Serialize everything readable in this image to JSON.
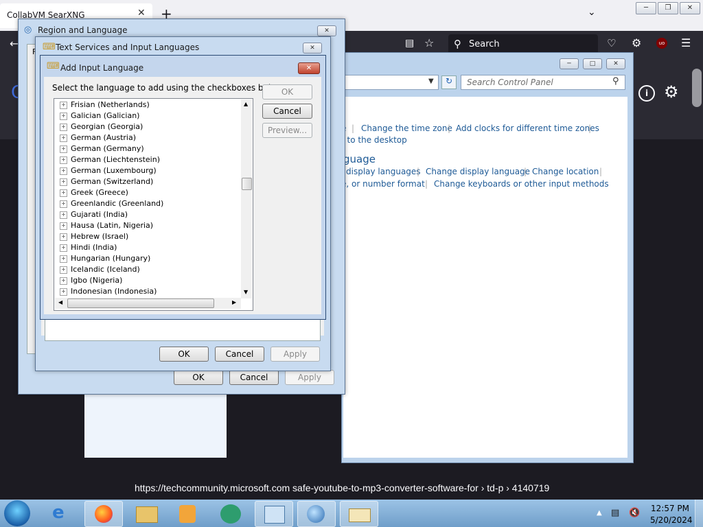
{
  "browser": {
    "tab_title": "CollabVM SearXNG",
    "tab_close": "✕",
    "new_tab": "+",
    "search_label": "Search",
    "status_url": "https://techcommunity.microsoft.com  safe-youtube-to-mp3-converter-software-for › td-p › 4140719"
  },
  "control_panel": {
    "search_placeholder": "Search Control Panel",
    "row1": [
      "e",
      "Change the time zone",
      "Add clocks for different time zones"
    ],
    "row2": "t to the desktop",
    "heading": "guage",
    "row3": [
      "display languages",
      "Change display language",
      "Change location"
    ],
    "row4": [
      "e, or number format",
      "Change keyboards or other input methods"
    ]
  },
  "region_dialog": {
    "title": "Region and Language",
    "tab_hint": "F",
    "ok": "OK",
    "cancel": "Cancel",
    "apply": "Apply"
  },
  "text_services_dialog": {
    "title": "Text Services and Input Languages",
    "ok": "OK",
    "cancel": "Cancel",
    "apply": "Apply"
  },
  "add_input_dialog": {
    "title": "Add Input Language",
    "instruction": "Select the language to add using the checkboxes below.",
    "ok": "OK",
    "cancel": "Cancel",
    "preview": "Preview...",
    "languages": [
      "Frisian (Netherlands)",
      "Galician (Galician)",
      "Georgian (Georgia)",
      "German (Austria)",
      "German (Germany)",
      "German (Liechtenstein)",
      "German (Luxembourg)",
      "German (Switzerland)",
      "Greek (Greece)",
      "Greenlandic (Greenland)",
      "Gujarati (India)",
      "Hausa (Latin, Nigeria)",
      "Hebrew (Israel)",
      "Hindi (India)",
      "Hungarian (Hungary)",
      "Icelandic (Iceland)",
      "Igbo (Nigeria)",
      "Indonesian (Indonesia)"
    ]
  },
  "taskbar": {
    "time": "12:57 PM",
    "date": "5/20/2024"
  },
  "colors": {
    "link": "#1e5a96",
    "taskbar": "#7fb0dc",
    "dialog_frame": "#c8dbf0",
    "firefox_dark": "#2b2a33"
  }
}
